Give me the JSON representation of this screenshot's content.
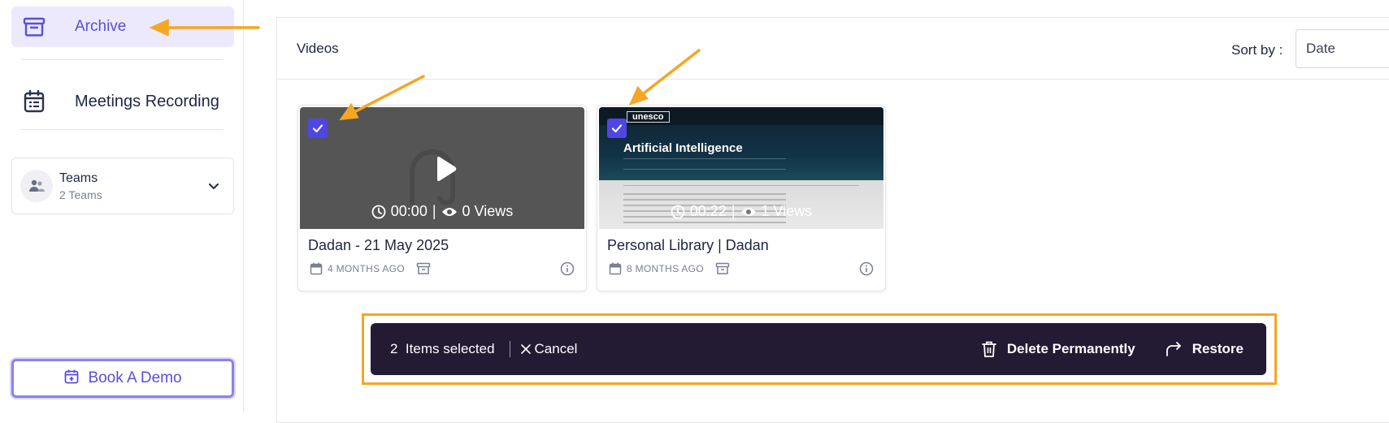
{
  "sidebar": {
    "archive_label": "Archive",
    "meetings_label": "Meetings Recording",
    "teams": {
      "title": "Teams",
      "count": "2 Teams"
    },
    "book_demo_label": "Book A Demo"
  },
  "main": {
    "section_title": "Videos",
    "sort_label": "Sort by :",
    "sort_value": "Date",
    "cards": [
      {
        "title": "Dadan - 21 May 2025",
        "duration": "00:00",
        "views": "0 Views",
        "age": "4 MONTHS AGO",
        "selected": true
      },
      {
        "title": "Personal Library | Dadan",
        "duration": "00:22",
        "views": "1 Views",
        "age": "8 MONTHS AGO",
        "selected": true,
        "thumb_site_logo": "unesco",
        "thumb_heading": "Artificial Intelligence"
      }
    ]
  },
  "selection_bar": {
    "count": "2",
    "items_selected_label": "Items selected",
    "cancel_label": "Cancel",
    "delete_label": "Delete Permanently",
    "restore_label": "Restore"
  },
  "colors": {
    "accent": "#5a4fd6",
    "checkbox": "#4f46e5",
    "annotation": "#f5a623",
    "selection_bar_bg": "#231a33"
  },
  "icons": [
    "archive-icon",
    "calendar-icon",
    "users-icon",
    "chevron-down-icon",
    "calendar-plus-icon",
    "play-icon",
    "clock-icon",
    "eye-icon",
    "info-icon",
    "trash-icon",
    "redo-icon",
    "close-icon",
    "check-icon"
  ]
}
